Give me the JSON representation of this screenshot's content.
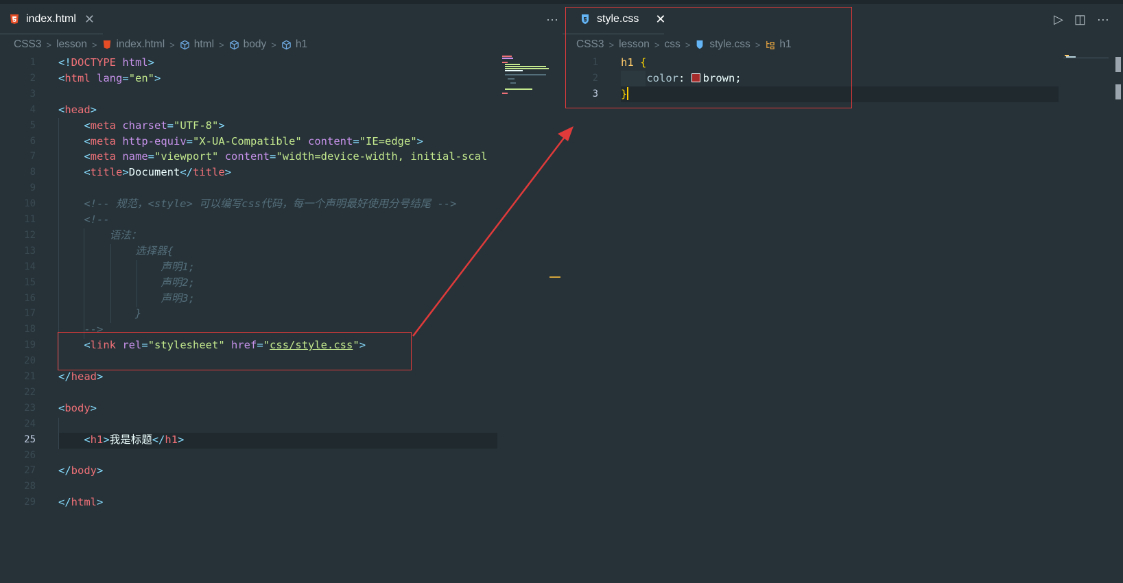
{
  "left_tab": {
    "label": "index.html",
    "close": "✕",
    "icon": "html-file-icon"
  },
  "right_tab": {
    "label": "style.css",
    "close": "✕",
    "icon": "css-file-icon"
  },
  "actions": {
    "more": "···",
    "run": "▷",
    "split": "◫"
  },
  "left_breadcrumb": [
    {
      "label": "CSS3",
      "icon": ""
    },
    {
      "label": "lesson",
      "icon": ""
    },
    {
      "label": "index.html",
      "icon": "html-file-icon"
    },
    {
      "label": "html",
      "icon": "cube-icon"
    },
    {
      "label": "body",
      "icon": "cube-icon"
    },
    {
      "label": "h1",
      "icon": "cube-icon"
    }
  ],
  "right_breadcrumb": [
    {
      "label": "CSS3",
      "icon": ""
    },
    {
      "label": "lesson",
      "icon": ""
    },
    {
      "label": "css",
      "icon": ""
    },
    {
      "label": "style.css",
      "icon": "css-file-icon"
    },
    {
      "label": "h1",
      "icon": "selector-icon"
    }
  ],
  "html_lines": [
    {
      "n": "1",
      "tokens": [
        [
          "punc",
          "<!"
        ],
        [
          "tag",
          "DOCTYPE"
        ],
        [
          "text",
          " "
        ],
        [
          "attr",
          "html"
        ],
        [
          "punc",
          ">"
        ]
      ]
    },
    {
      "n": "2",
      "tokens": [
        [
          "punc",
          "<"
        ],
        [
          "tag",
          "html"
        ],
        [
          "text",
          " "
        ],
        [
          "attr",
          "lang"
        ],
        [
          "punc",
          "="
        ],
        [
          "str",
          "\"en\""
        ],
        [
          "punc",
          ">"
        ]
      ]
    },
    {
      "n": "3",
      "tokens": []
    },
    {
      "n": "4",
      "tokens": [
        [
          "punc",
          "<"
        ],
        [
          "tag",
          "head"
        ],
        [
          "punc",
          ">"
        ]
      ]
    },
    {
      "n": "5",
      "tokens": [
        [
          "text",
          "    "
        ],
        [
          "punc",
          "<"
        ],
        [
          "tag",
          "meta"
        ],
        [
          "text",
          " "
        ],
        [
          "attr",
          "charset"
        ],
        [
          "punc",
          "="
        ],
        [
          "str",
          "\"UTF-8\""
        ],
        [
          "punc",
          ">"
        ]
      ]
    },
    {
      "n": "6",
      "tokens": [
        [
          "text",
          "    "
        ],
        [
          "punc",
          "<"
        ],
        [
          "tag",
          "meta"
        ],
        [
          "text",
          " "
        ],
        [
          "attr",
          "http-equiv"
        ],
        [
          "punc",
          "="
        ],
        [
          "str",
          "\"X-UA-Compatible\""
        ],
        [
          "text",
          " "
        ],
        [
          "attr",
          "content"
        ],
        [
          "punc",
          "="
        ],
        [
          "str",
          "\"IE=edge\""
        ],
        [
          "punc",
          ">"
        ]
      ]
    },
    {
      "n": "7",
      "tokens": [
        [
          "text",
          "    "
        ],
        [
          "punc",
          "<"
        ],
        [
          "tag",
          "meta"
        ],
        [
          "text",
          " "
        ],
        [
          "attr",
          "name"
        ],
        [
          "punc",
          "="
        ],
        [
          "str",
          "\"viewport\""
        ],
        [
          "text",
          " "
        ],
        [
          "attr",
          "content"
        ],
        [
          "punc",
          "="
        ],
        [
          "str",
          "\"width=device-width, initial-scal"
        ]
      ]
    },
    {
      "n": "8",
      "tokens": [
        [
          "text",
          "    "
        ],
        [
          "punc",
          "<"
        ],
        [
          "tag",
          "title"
        ],
        [
          "punc",
          ">"
        ],
        [
          "text",
          "Document"
        ],
        [
          "punc",
          "</"
        ],
        [
          "tag",
          "title"
        ],
        [
          "punc",
          ">"
        ]
      ]
    },
    {
      "n": "9",
      "tokens": []
    },
    {
      "n": "10",
      "tokens": [
        [
          "text",
          "    "
        ],
        [
          "cmt",
          "<!-- 规范，<style> 可以编写css代码，每一个声明最好使用分号结尾 -->"
        ]
      ]
    },
    {
      "n": "11",
      "tokens": [
        [
          "text",
          "    "
        ],
        [
          "cmt",
          "<!--"
        ]
      ]
    },
    {
      "n": "12",
      "tokens": [
        [
          "text",
          "        "
        ],
        [
          "cmt",
          "语法："
        ]
      ]
    },
    {
      "n": "13",
      "tokens": [
        [
          "text",
          "            "
        ],
        [
          "cmt",
          "选择器{"
        ]
      ]
    },
    {
      "n": "14",
      "tokens": [
        [
          "text",
          "                "
        ],
        [
          "cmt",
          "声明1;"
        ]
      ]
    },
    {
      "n": "15",
      "tokens": [
        [
          "text",
          "                "
        ],
        [
          "cmt",
          "声明2;"
        ]
      ]
    },
    {
      "n": "16",
      "tokens": [
        [
          "text",
          "                "
        ],
        [
          "cmt",
          "声明3;"
        ]
      ]
    },
    {
      "n": "17",
      "tokens": [
        [
          "text",
          "            "
        ],
        [
          "cmt",
          "}"
        ]
      ]
    },
    {
      "n": "18",
      "tokens": [
        [
          "text",
          "    "
        ],
        [
          "cmt",
          "-->"
        ]
      ]
    },
    {
      "n": "19",
      "tokens": [
        [
          "text",
          "    "
        ],
        [
          "punc",
          "<"
        ],
        [
          "tag",
          "link"
        ],
        [
          "text",
          " "
        ],
        [
          "attr",
          "rel"
        ],
        [
          "punc",
          "="
        ],
        [
          "str",
          "\"stylesheet\""
        ],
        [
          "text",
          " "
        ],
        [
          "attr",
          "href"
        ],
        [
          "punc",
          "="
        ],
        [
          "str",
          "\""
        ],
        [
          "link",
          "css/style.css"
        ],
        [
          "str",
          "\""
        ],
        [
          "punc",
          ">"
        ]
      ]
    },
    {
      "n": "20",
      "tokens": []
    },
    {
      "n": "21",
      "tokens": [
        [
          "punc",
          "</"
        ],
        [
          "tag",
          "head"
        ],
        [
          "punc",
          ">"
        ]
      ]
    },
    {
      "n": "22",
      "tokens": []
    },
    {
      "n": "23",
      "tokens": [
        [
          "punc",
          "<"
        ],
        [
          "tag",
          "body"
        ],
        [
          "punc",
          ">"
        ]
      ]
    },
    {
      "n": "24",
      "tokens": []
    },
    {
      "n": "25",
      "tokens": [
        [
          "text",
          "    "
        ],
        [
          "punc",
          "<"
        ],
        [
          "tag",
          "h1"
        ],
        [
          "punc",
          ">"
        ],
        [
          "text",
          "我是标题"
        ],
        [
          "punc",
          "</"
        ],
        [
          "tag",
          "h1"
        ],
        [
          "punc",
          ">"
        ]
      ]
    },
    {
      "n": "26",
      "tokens": []
    },
    {
      "n": "27",
      "tokens": [
        [
          "punc",
          "</"
        ],
        [
          "tag",
          "body"
        ],
        [
          "punc",
          ">"
        ]
      ]
    },
    {
      "n": "28",
      "tokens": []
    },
    {
      "n": "29",
      "tokens": [
        [
          "punc",
          "</"
        ],
        [
          "tag",
          "html"
        ],
        [
          "punc",
          ">"
        ]
      ]
    }
  ],
  "css_lines": [
    {
      "n": "1",
      "tokens": [
        [
          "sel",
          "h1"
        ],
        [
          "text",
          " "
        ],
        [
          "brace",
          "{"
        ]
      ]
    },
    {
      "n": "2",
      "tokens": [
        [
          "text",
          "    "
        ],
        [
          "prop",
          "color"
        ],
        [
          "text",
          ": "
        ],
        [
          "swatch",
          ""
        ],
        [
          "text",
          "brown;"
        ]
      ]
    },
    {
      "n": "3",
      "tokens": [
        [
          "brace",
          "}"
        ],
        [
          "cursor",
          ""
        ]
      ]
    }
  ],
  "active_html_line": "25",
  "active_css_line": "3",
  "colors": {
    "annotation": "#e03a3a",
    "swatch": "#a52a2a",
    "accent": "#80cbc4"
  }
}
